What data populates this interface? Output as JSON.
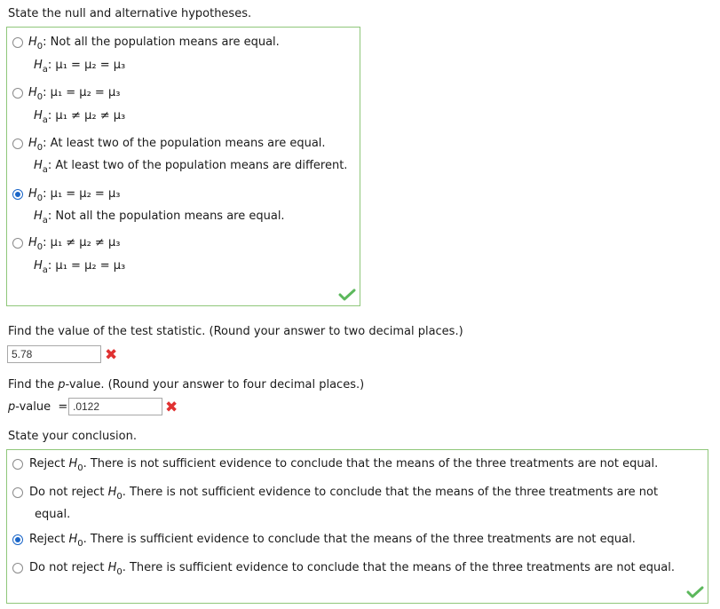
{
  "q1": {
    "prompt": "State the null and alternative hypotheses.",
    "options": [
      {
        "h0_label": "H",
        "h0_sub": "0",
        "h0_text": ": Not all the population means are equal.",
        "ha_label": "H",
        "ha_sub": "a",
        "ha_text": ": μ₁ = μ₂ = μ₃",
        "selected": false
      },
      {
        "h0_label": "H",
        "h0_sub": "0",
        "h0_text": ": μ₁ = μ₂ = μ₃",
        "ha_label": "H",
        "ha_sub": "a",
        "ha_text": ": μ₁ ≠ μ₂ ≠ μ₃",
        "selected": false
      },
      {
        "h0_label": "H",
        "h0_sub": "0",
        "h0_text": ": At least two of the population means are equal.",
        "ha_label": "H",
        "ha_sub": "a",
        "ha_text": ": At least two of the population means are different.",
        "selected": false
      },
      {
        "h0_label": "H",
        "h0_sub": "0",
        "h0_text": ": μ₁ = μ₂ = μ₃",
        "ha_label": "H",
        "ha_sub": "a",
        "ha_text": ": Not all the population means are equal.",
        "selected": true
      },
      {
        "h0_label": "H",
        "h0_sub": "0",
        "h0_text": ": μ₁ ≠ μ₂ ≠ μ₃",
        "ha_label": "H",
        "ha_sub": "a",
        "ha_text": ": μ₁ = μ₂ = μ₃",
        "selected": false
      }
    ],
    "status": "correct"
  },
  "q2": {
    "prompt": "Find the value of the test statistic. (Round your answer to two decimal places.)",
    "answer": "5.78",
    "status": "incorrect"
  },
  "q3": {
    "prompt_pre": "Find the ",
    "prompt_italic": "p",
    "prompt_post": "-value. (Round your answer to four decimal places.)",
    "label_italic": "p",
    "label_post": "-value  =",
    "answer": ".0122",
    "status": "incorrect"
  },
  "q4": {
    "prompt": "State your conclusion.",
    "options": [
      {
        "pre": "Reject ",
        "h": "H",
        "sub": "0",
        "post": ". There is not sufficient evidence to conclude that the means of the three treatments are not equal.",
        "selected": false
      },
      {
        "pre": "Do not reject ",
        "h": "H",
        "sub": "0",
        "post": ". There is not sufficient evidence to conclude that the means of the three treatments are not",
        "cont": "equal.",
        "selected": false
      },
      {
        "pre": "Reject ",
        "h": "H",
        "sub": "0",
        "post": ". There is sufficient evidence to conclude that the means of the three treatments are not equal.",
        "selected": true
      },
      {
        "pre": "Do not reject ",
        "h": "H",
        "sub": "0",
        "post": ". There is sufficient evidence to conclude that the means of the three treatments are not equal.",
        "selected": false
      }
    ],
    "status": "correct"
  },
  "colors": {
    "correct": "#5cb85c",
    "incorrect": "#e03131",
    "radio_selected": "#1a66c8",
    "box_border": "#8fc77a"
  },
  "icons": {
    "correct": "checkmark-icon",
    "incorrect": "x-mark-icon"
  }
}
